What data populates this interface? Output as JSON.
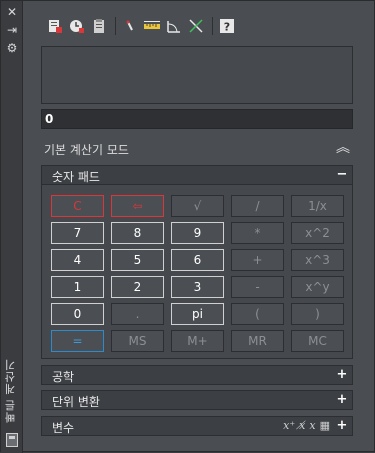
{
  "palette": {
    "title": "빠른 계산기",
    "controls": {
      "close": "✕",
      "auto_hide": "⇥",
      "properties": "⚙"
    }
  },
  "toolbar": {
    "tools": [
      {
        "name": "clear",
        "icon": "eraser-icon"
      },
      {
        "name": "clear-history",
        "icon": "history-icon"
      },
      {
        "name": "paste",
        "icon": "paste-icon"
      },
      {
        "name": "get-coordinates",
        "icon": "coordinate-pick-icon"
      },
      {
        "name": "distance",
        "icon": "measure-distance-icon"
      },
      {
        "name": "angle",
        "icon": "angle-icon"
      },
      {
        "name": "intersection",
        "icon": "intersection-icon"
      },
      {
        "name": "help",
        "icon": "help-icon",
        "label": "?"
      }
    ]
  },
  "display": {
    "value": "0"
  },
  "mode": {
    "label": "기본 계산기 모드",
    "toggle": "︽"
  },
  "numpad": {
    "title": "숫자 패드",
    "toggle": "−",
    "rows": [
      [
        {
          "label": "C",
          "style": "danger"
        },
        {
          "label": "⇦",
          "style": "danger"
        },
        {
          "label": "√",
          "style": "normal"
        },
        {
          "label": "/",
          "style": "normal"
        },
        {
          "label": "1/x",
          "style": "normal"
        }
      ],
      [
        {
          "label": "7",
          "style": "active"
        },
        {
          "label": "8",
          "style": "active"
        },
        {
          "label": "9",
          "style": "active"
        },
        {
          "label": "*",
          "style": "normal"
        },
        {
          "label": "x^2",
          "style": "normal"
        }
      ],
      [
        {
          "label": "4",
          "style": "active"
        },
        {
          "label": "5",
          "style": "active"
        },
        {
          "label": "6",
          "style": "active"
        },
        {
          "label": "+",
          "style": "normal"
        },
        {
          "label": "x^3",
          "style": "normal"
        }
      ],
      [
        {
          "label": "1",
          "style": "active"
        },
        {
          "label": "2",
          "style": "active"
        },
        {
          "label": "3",
          "style": "active"
        },
        {
          "label": "-",
          "style": "normal"
        },
        {
          "label": "x^y",
          "style": "normal"
        }
      ],
      [
        {
          "label": "0",
          "style": "active"
        },
        {
          "label": ".",
          "style": "normal"
        },
        {
          "label": "pi",
          "style": "active"
        },
        {
          "label": "(",
          "style": "normal"
        },
        {
          "label": ")",
          "style": "normal"
        }
      ],
      [
        {
          "label": "=",
          "style": "primary"
        },
        {
          "label": "MS",
          "style": "normal"
        },
        {
          "label": "M+",
          "style": "normal"
        },
        {
          "label": "MR",
          "style": "normal"
        },
        {
          "label": "MC",
          "style": "normal"
        }
      ]
    ]
  },
  "sections": {
    "scientific": {
      "label": "공학",
      "toggle": "+"
    },
    "units": {
      "label": "단위 변환",
      "toggle": "+"
    },
    "variables": {
      "label": "변수",
      "toggle": "+",
      "icons": [
        "x-new-icon",
        "x-edit-icon",
        "x-delete-icon",
        "calculator-icon"
      ]
    }
  },
  "colors": {
    "background": "#4a4d52",
    "danger": "#d8383a",
    "primary": "#2e8ac8",
    "text": "#dcdcdc"
  }
}
